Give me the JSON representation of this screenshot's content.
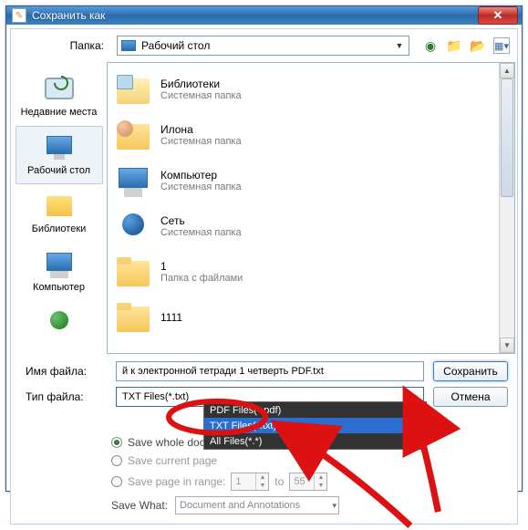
{
  "window": {
    "title": "Сохранить как"
  },
  "folder_row": {
    "label": "Папка:",
    "value": "Рабочий стол"
  },
  "places": [
    {
      "key": "recent",
      "label": "Недавние места"
    },
    {
      "key": "desktop",
      "label": "Рабочий стол"
    },
    {
      "key": "libs",
      "label": "Библиотеки"
    },
    {
      "key": "computer",
      "label": "Компьютер"
    },
    {
      "key": "network",
      "label": ""
    }
  ],
  "files": [
    {
      "name": "Библиотеки",
      "sub": "Системная папка",
      "icon": "folder open libs-overlay"
    },
    {
      "name": "Илона",
      "sub": "Системная папка",
      "icon": "folder user"
    },
    {
      "name": "Компьютер",
      "sub": "Системная папка",
      "icon": "pc"
    },
    {
      "name": "Сеть",
      "sub": "Системная папка",
      "icon": "net"
    },
    {
      "name": "1",
      "sub": "Папка с файлами",
      "icon": "folder"
    },
    {
      "name": "1111",
      "sub": "",
      "icon": "folder"
    }
  ],
  "form": {
    "filename_label": "Имя файла:",
    "filename_value": "й к электронной тетради 1 четверть PDF.txt",
    "filetype_label": "Тип файла:",
    "filetype_value": "TXT Files(*.txt)",
    "save_button": "Сохранить",
    "cancel_button": "Отмена"
  },
  "dropdown_options": [
    {
      "label": "PDF Files(*.pdf)",
      "style": "dark"
    },
    {
      "label": "TXT Files(*.txt)",
      "style": "sel"
    },
    {
      "label": "All Files(*.*)",
      "style": "dark"
    }
  ],
  "save_opts": {
    "whole": "Save whole document",
    "current": "Save current page",
    "range": "Save page in range:",
    "from": "1",
    "to_label": "to",
    "to": "55"
  },
  "savewhat": {
    "label": "Save What:",
    "value": "Document and Annotations"
  }
}
